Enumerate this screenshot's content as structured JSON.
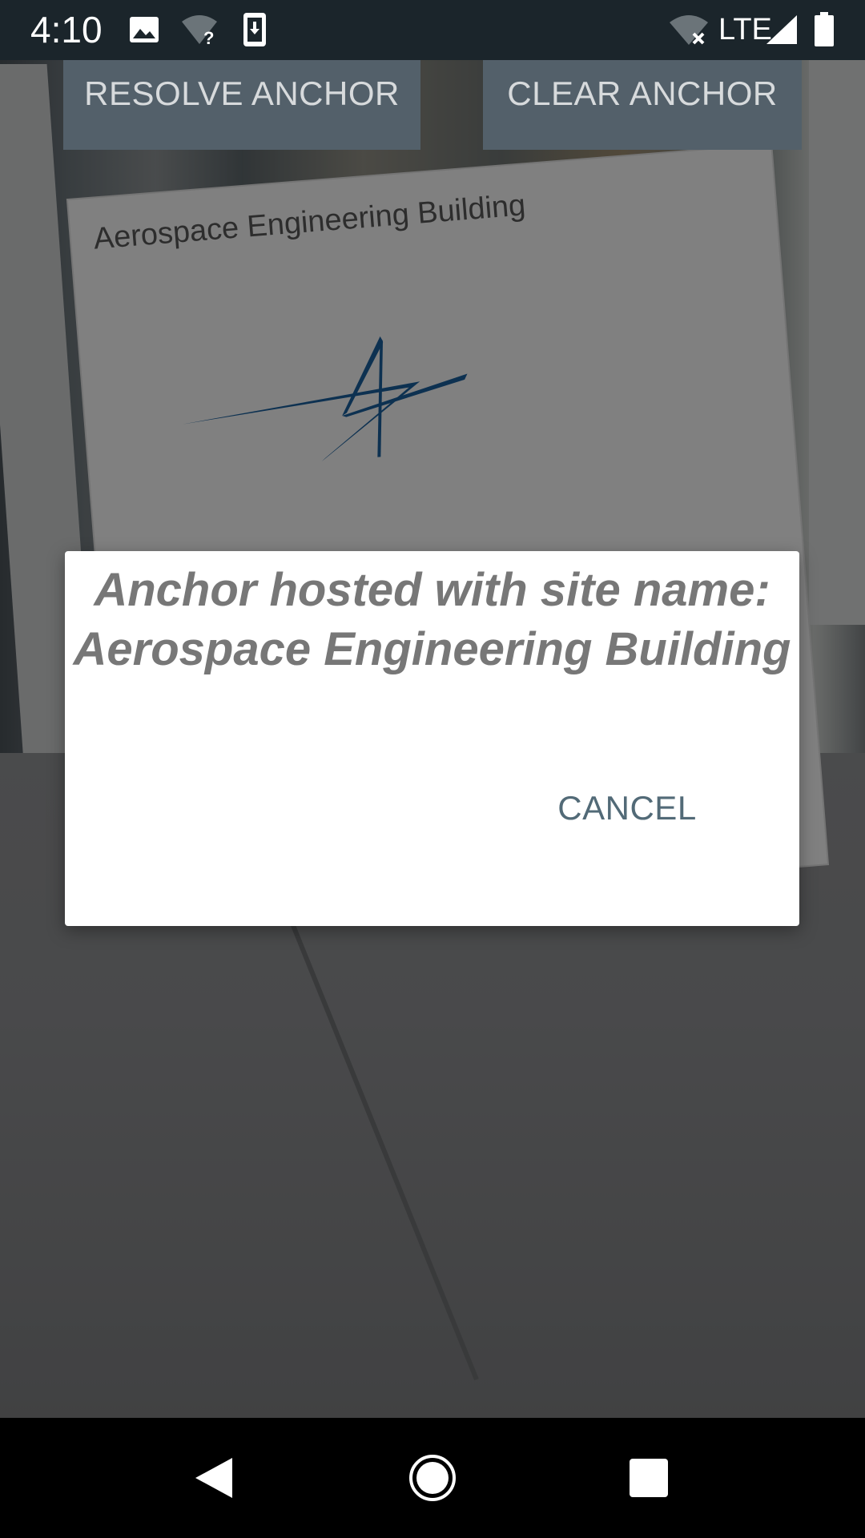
{
  "status_bar": {
    "time": "4:10",
    "network_type": "LTE",
    "icons": [
      "image-icon",
      "wifi-unknown-icon",
      "download-icon",
      "wifi-off-icon",
      "signal-icon",
      "battery-icon"
    ]
  },
  "toolbar": {
    "resolve_label": "RESOLVE ANCHOR",
    "clear_label": "CLEAR ANCHOR"
  },
  "camera_view": {
    "sign_text": "Aerospace Engineering Building"
  },
  "dialog": {
    "title": "Anchor hosted with site name: Aerospace Engineering Building",
    "cancel_label": "CANCEL"
  },
  "nav_bar": {
    "icons": [
      "back-icon",
      "home-icon",
      "recents-icon"
    ]
  },
  "colors": {
    "status_bar_bg": "#1b252b",
    "button_bg": "#53606a",
    "dialog_title": "#777777",
    "cancel_text": "#526a77",
    "logo_blue": "#1a5e9a"
  }
}
